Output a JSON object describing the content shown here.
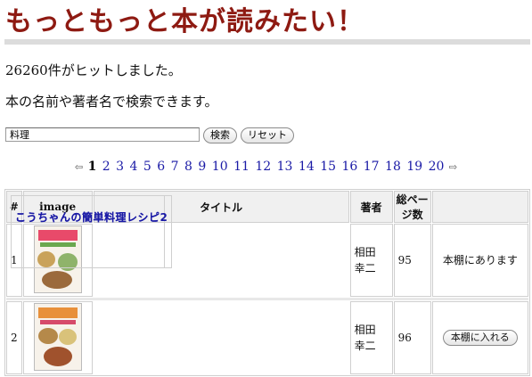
{
  "header": {
    "title": "もっともっと本が読みたい！"
  },
  "results": {
    "hit_text": "26260件がヒットしました。",
    "hint_text": "本の名前や著者名で検索できます。"
  },
  "search": {
    "value": "料理",
    "search_label": "検索",
    "reset_label": "リセット"
  },
  "pager": {
    "prev": "⇦",
    "next": "⇨",
    "current": "1",
    "pages": [
      "2",
      "3",
      "4",
      "5",
      "6",
      "7",
      "8",
      "9",
      "10",
      "11",
      "12",
      "13",
      "14",
      "15",
      "16",
      "17",
      "18",
      "19",
      "20"
    ]
  },
  "table": {
    "headers": {
      "num": "#",
      "image": "image",
      "title": "タイトル",
      "author": "著者",
      "pages": "総ページ数"
    },
    "rows": [
      {
        "num": "1",
        "title": "こうちゃんの簡単料理レシピ",
        "author": "相田 幸二",
        "pages": "95",
        "status": "本棚にあります"
      },
      {
        "num": "2",
        "title": "こうちゃんの簡単料理レシピ2",
        "author": "相田 幸二",
        "pages": "96",
        "action_label": "本棚に入れる"
      }
    ]
  },
  "colors": {
    "title": "#8e1a12",
    "link": "#1a1aa6",
    "rule": "#dcdcdc"
  },
  "icons": {
    "prev": "left-arrow-icon",
    "next": "right-arrow-icon"
  }
}
